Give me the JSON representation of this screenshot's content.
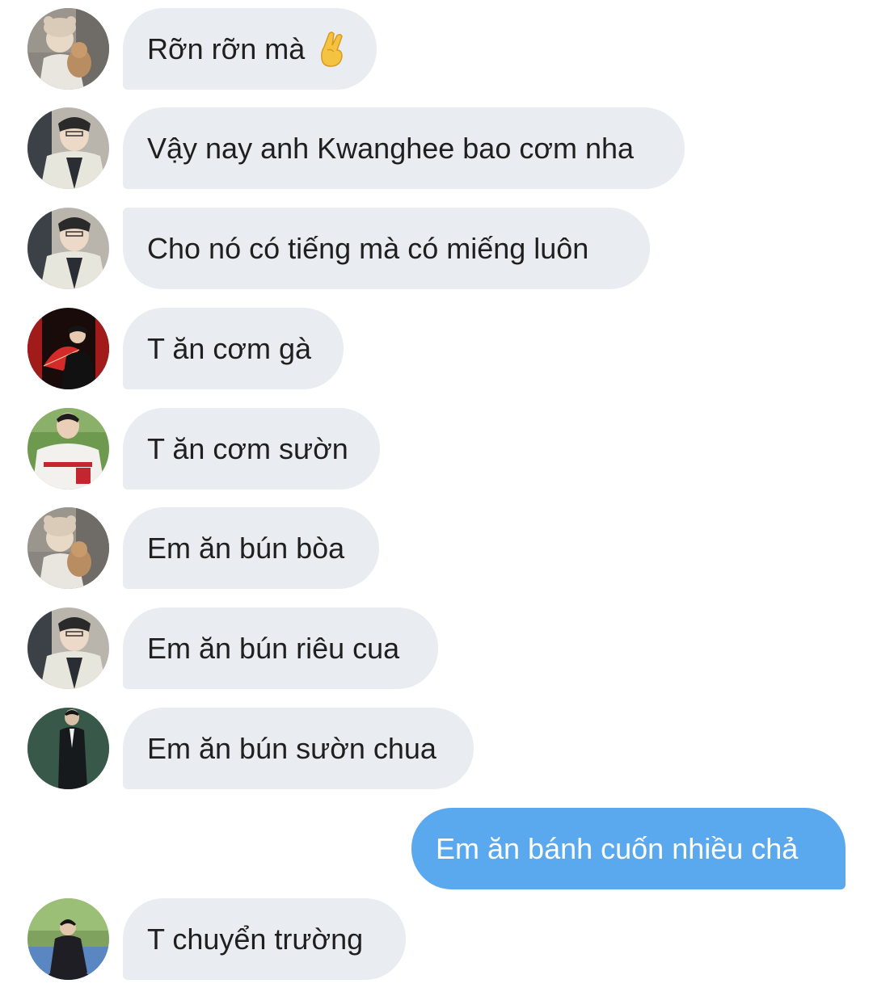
{
  "messages": [
    {
      "text": "Rỡn rỡn mà",
      "emoji": "crossed-fingers-icon",
      "direction": "incoming",
      "avatar": "user-bear-hat"
    },
    {
      "text": "Vậy nay anh Kwanghee bao cơm nha",
      "direction": "incoming",
      "avatar": "user-cardigan"
    },
    {
      "text": "Cho nó có tiếng mà có miếng luôn",
      "direction": "incoming",
      "avatar": "user-cardigan"
    },
    {
      "text": "T ăn cơm gà",
      "direction": "incoming",
      "avatar": "user-red-fan"
    },
    {
      "text": "T ăn cơm sườn",
      "direction": "incoming",
      "avatar": "user-baseball-jersey"
    },
    {
      "text": "Em ăn bún bòa",
      "direction": "incoming",
      "avatar": "user-bear-hat"
    },
    {
      "text": "Em ăn bún riêu cua",
      "direction": "incoming",
      "avatar": "user-cardigan"
    },
    {
      "text": "Em ăn bún sườn chua",
      "direction": "incoming",
      "avatar": "user-black-suit"
    },
    {
      "text": "Em ăn bánh cuốn nhiều chả",
      "direction": "outgoing"
    },
    {
      "text": "T chuyển trường",
      "direction": "incoming",
      "avatar": "user-outdoor-court"
    }
  ],
  "colors": {
    "incoming_bubble": "#e9ecf0",
    "outgoing_bubble": "#5aa8ee",
    "incoming_text": "#1f1f1f",
    "outgoing_text": "#ffffff"
  }
}
